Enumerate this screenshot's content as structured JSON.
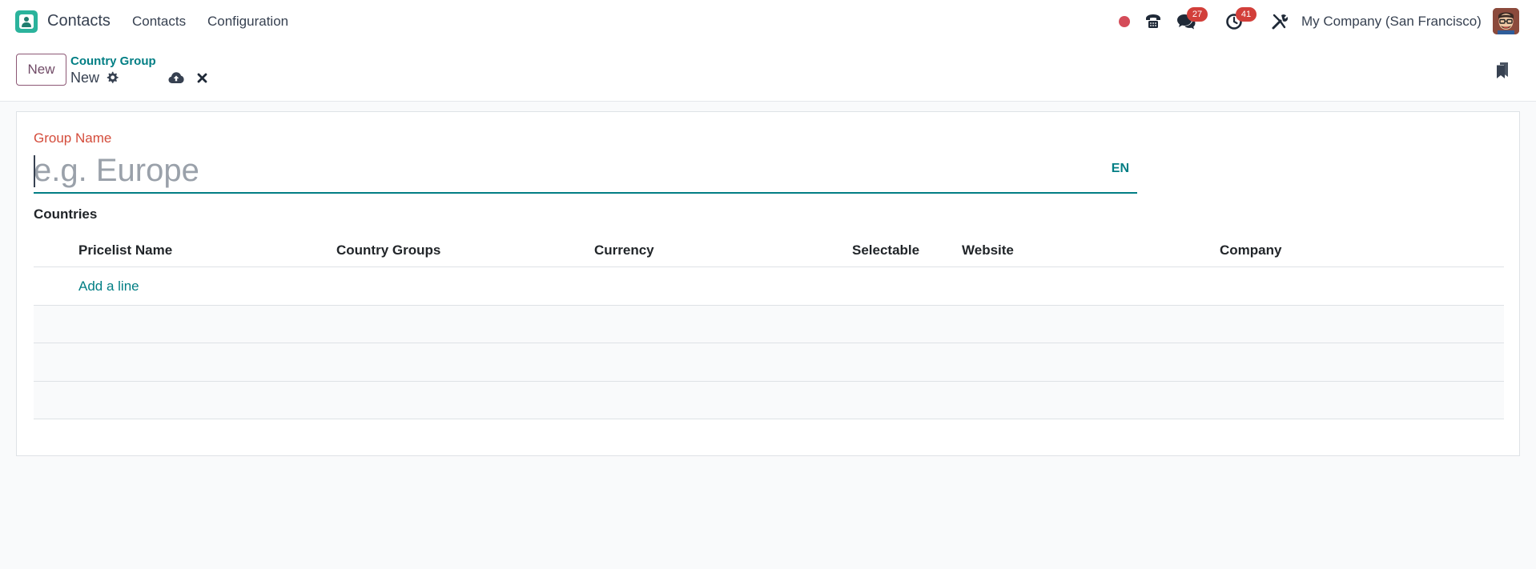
{
  "navbar": {
    "app_name": "Contacts",
    "menus": [
      "Contacts",
      "Configuration"
    ],
    "messages_count": "27",
    "activities_count": "41",
    "company": "My Company (San Francisco)"
  },
  "control_panel": {
    "new_button": "New",
    "breadcrumb": "Country Group",
    "record_title": "New"
  },
  "form": {
    "name_label": "Group Name",
    "name_value": "",
    "name_placeholder": "e.g. Europe",
    "lang_button": "EN",
    "countries_title": "Countries"
  },
  "table": {
    "columns": [
      "Pricelist Name",
      "Country Groups",
      "Currency",
      "Selectable",
      "Website",
      "Company"
    ],
    "add_line": "Add a line"
  },
  "colors": {
    "accent": "#017e84",
    "brand": "#714b67",
    "required_label": "#d44c3b",
    "badge": "#d23f3a"
  }
}
